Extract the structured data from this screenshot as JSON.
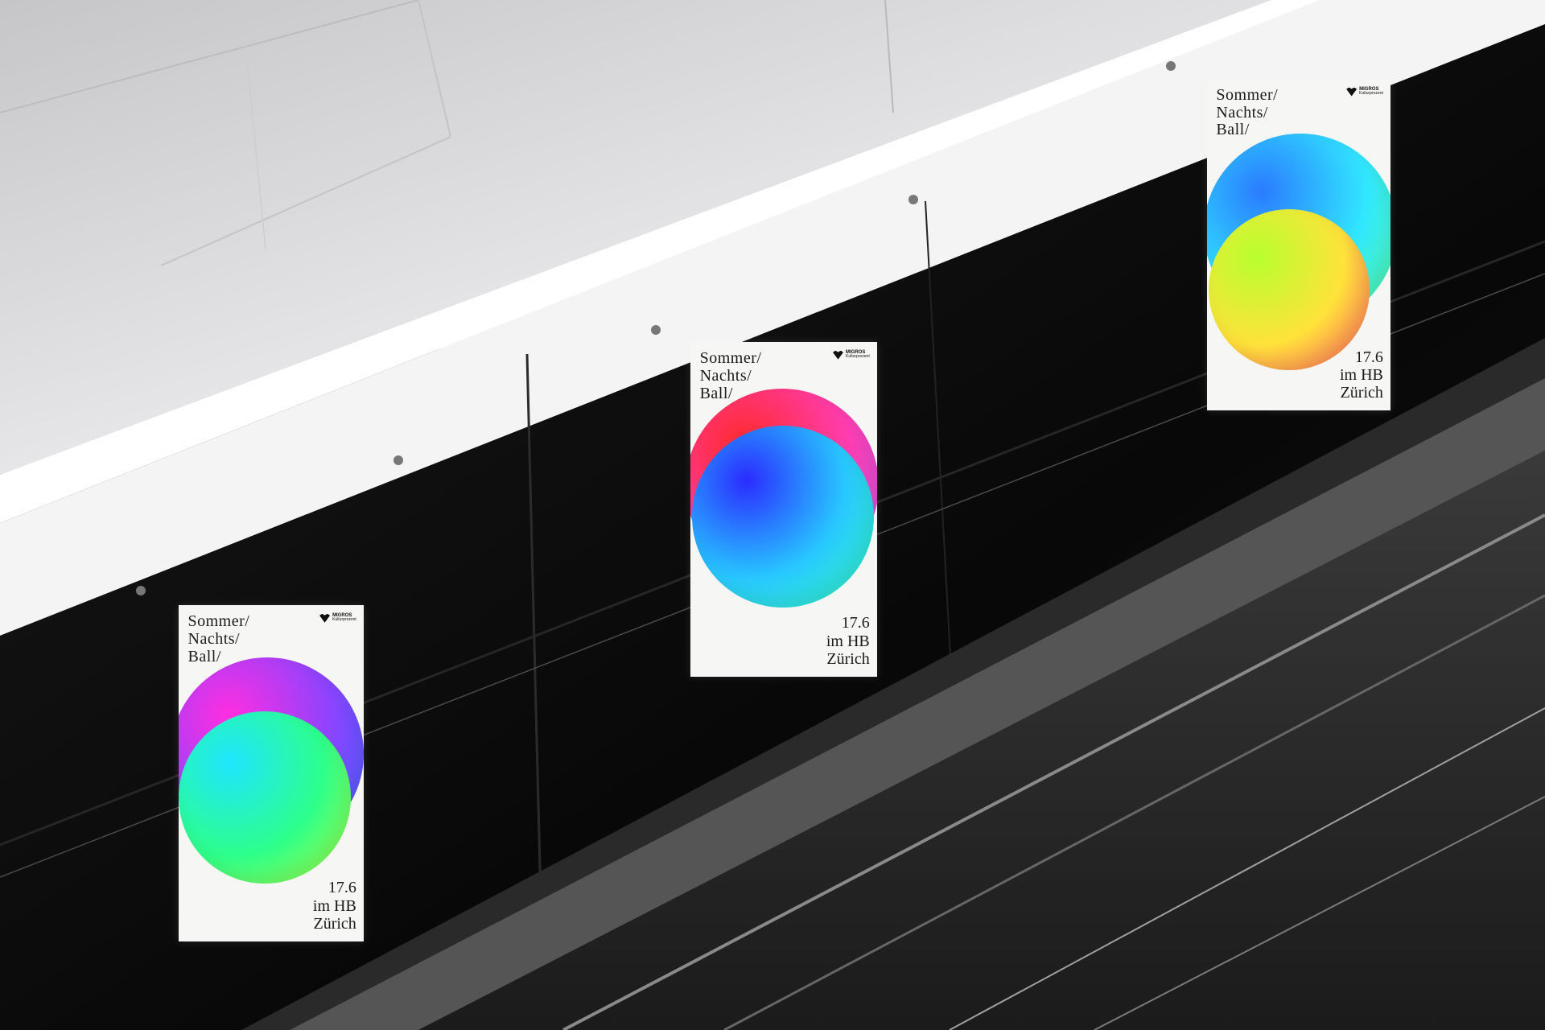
{
  "posters": [
    {
      "title_lines": "Sommer/\nNachts/\nBall/",
      "info_lines": "17.6\nim HB\nZürich",
      "logo": {
        "brand": "MIGROS",
        "sub": "Kulturprozent"
      },
      "colors": {
        "back_orb": [
          "#ff2ee0",
          "#8a44ff",
          "#2f6bff"
        ],
        "front_orb": [
          "#1fe6ff",
          "#2dff8a",
          "#b6ff3a"
        ]
      }
    },
    {
      "title_lines": "Sommer/\nNachts/\nBall/",
      "info_lines": "17.6\nim HB\nZürich",
      "logo": {
        "brand": "MIGROS",
        "sub": "Kulturprozent"
      },
      "colors": {
        "back_orb": [
          "#ff2a2a",
          "#ff3db0",
          "#b45cff"
        ],
        "front_orb": [
          "#2a2cff",
          "#28c8ff",
          "#35ffb8"
        ]
      }
    },
    {
      "title_lines": "Sommer/\nNachts/\nBall/",
      "info_lines": "17.6\nim HB\nZürich",
      "logo": {
        "brand": "MIGROS",
        "sub": "Kulturprozent"
      },
      "colors": {
        "back_orb": [
          "#2a7bff",
          "#31e7ff",
          "#5cff86"
        ],
        "front_orb": [
          "#b8ff2e",
          "#ffe23a",
          "#ff4f6a"
        ]
      }
    }
  ],
  "scene_colors": {
    "ceiling": "#d9d9db",
    "wall": "#0d0d0d",
    "light_strip": "#ffffff"
  }
}
